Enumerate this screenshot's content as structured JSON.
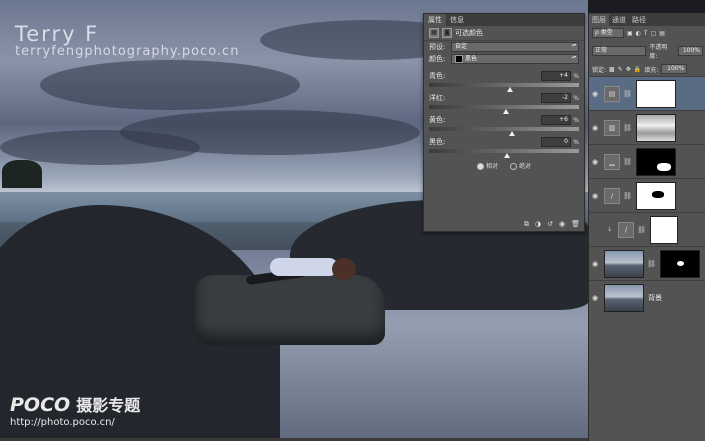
{
  "watermark": {
    "title": "Terry F",
    "url": "terryfengphotography.poco.cn",
    "brand": "POCO",
    "brand_cn": "摄影专题",
    "site": "http://photo.poco.cn/"
  },
  "properties_panel": {
    "tabs": [
      "属性",
      "信息"
    ],
    "header": "可选颜色",
    "preset_label": "预设:",
    "preset_value": "自定",
    "color_label": "颜色:",
    "color_value": "黑色",
    "sliders": [
      {
        "label": "青色:",
        "value": "+4",
        "unit": "%",
        "level": 0.52
      },
      {
        "label": "洋红:",
        "value": "-2",
        "unit": "%",
        "level": 0.49
      },
      {
        "label": "黄色:",
        "value": "+6",
        "unit": "%",
        "level": 0.53
      },
      {
        "label": "黑色:",
        "value": "0",
        "unit": "%",
        "level": 0.5
      }
    ],
    "method_relative": "相对",
    "method_absolute": "绝对",
    "selected_method": "relative"
  },
  "layers_panel": {
    "tabs": [
      "图层",
      "通道",
      "路径"
    ],
    "kind_filter": "类型",
    "blend_mode": "正常",
    "opacity_label": "不透明度:",
    "opacity_value": "100%",
    "lock_label": "锁定:",
    "fill_label": "填充:",
    "fill_value": "100%",
    "background_layer_name": "背景"
  }
}
